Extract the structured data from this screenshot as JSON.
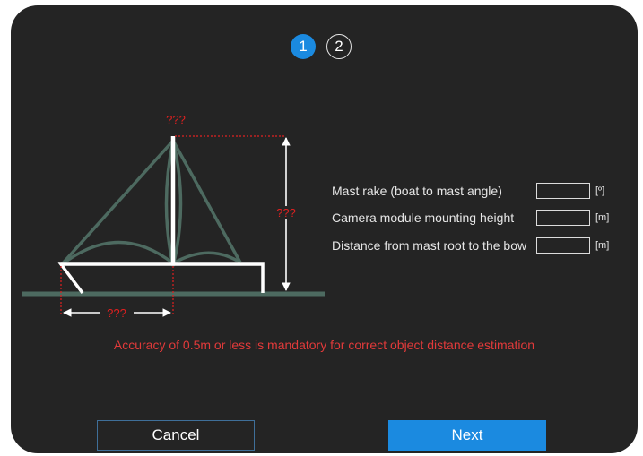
{
  "steps": [
    {
      "number": "1",
      "active": true
    },
    {
      "number": "2",
      "active": false
    }
  ],
  "diagram": {
    "unknown_marker": "???",
    "colors": {
      "boat": "#ffffff",
      "sail": "#4d6a60",
      "water": "#4d6a60",
      "dimension": "#e02020"
    }
  },
  "fields": [
    {
      "label": "Mast rake (boat to mast angle)",
      "value": "",
      "unit": "[º]"
    },
    {
      "label": "Camera module mounting height",
      "value": "",
      "unit": "[m]"
    },
    {
      "label": "Distance from mast root to the bow",
      "value": "",
      "unit": "[m]"
    }
  ],
  "warning": "Accuracy of 0.5m or less is mandatory for correct object distance estimation",
  "buttons": {
    "cancel": "Cancel",
    "next": "Next"
  },
  "colors": {
    "background": "#242424",
    "accent": "#1b8ae0",
    "warning": "#e23a3a"
  }
}
